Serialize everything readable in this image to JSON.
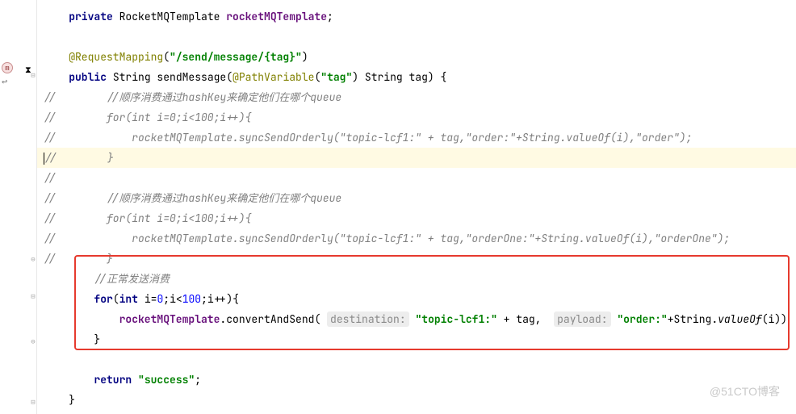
{
  "gutter": {
    "m_icon": "m"
  },
  "code": {
    "l1": {
      "kw": "private",
      "type": " RocketMQTemplate ",
      "field": "rocketMQTemplate",
      "semi": ";"
    },
    "l2": {
      "anno": "@RequestMapping",
      "paren_open": "(",
      "str": "\"/send/message/{tag}\"",
      "paren_close": ")"
    },
    "l3": {
      "kw1": "public",
      "type": " String ",
      "method": "sendMessage",
      "paren_open": "(",
      "anno": "@PathVariable",
      "anno_paren_open": "(",
      "anno_str": "\"tag\"",
      "anno_paren_close": ")",
      "param_type": " String tag",
      "paren_close": ") {"
    },
    "l4": {
      "cmt": "//        //顺序消费通过hashKey来确定他们在哪个queue"
    },
    "l5": {
      "slash": "//",
      "cmt": "        for(int i=0;i<100;i++){"
    },
    "l6": {
      "slash": "//",
      "cmt": "            rocketMQTemplate.syncSendOrderly(\"topic-lcf1:\" + tag,\"order:\"+String.valueOf(i),\"order\");"
    },
    "l7": {
      "slash": "//",
      "cmt": "        }"
    },
    "l8": {
      "slash": "//",
      "cmt": ""
    },
    "l9": {
      "slash": "//",
      "cmt": "        //顺序消费通过hashKey来确定他们在哪个queue"
    },
    "l10": {
      "slash": "//",
      "cmt": "        for(int i=0;i<100;i++){"
    },
    "l11": {
      "slash": "//",
      "cmt": "            rocketMQTemplate.syncSendOrderly(\"topic-lcf1:\" + tag,\"orderOne:\"+String.valueOf(i),\"orderOne\");"
    },
    "l12": {
      "slash": "//",
      "cmt": "        }"
    },
    "l13": {
      "cmt": "//正常发送消费"
    },
    "l14": {
      "kw_for": "for",
      "paren_open": "(",
      "kw_int": "int",
      "var": " i",
      "eq": "=",
      "n0": "0",
      "semi1": ";",
      "var2": "i",
      "lt": "<",
      "n100": "100",
      "semi2": ";",
      "var3": "i",
      "inc": "++",
      "paren_close": "){"
    },
    "l15": {
      "field": "rocketMQTemplate",
      "dot": ".",
      "method": "convertAndSend",
      "paren_open": "( ",
      "hint1": "destination:",
      "sp1": " ",
      "str1": "\"topic-lcf1:\"",
      "plus1": " + tag, ",
      "sp2": " ",
      "hint2": "payload:",
      "sp3": " ",
      "str2": "\"order:\"",
      "plus2": "+String.",
      "val": "valueOf",
      "paren_i": "(i))"
    },
    "l16": {
      "brace": "}"
    },
    "l17": {
      "kw": "return",
      "sp": " ",
      "str": "\"success\"",
      "semi": ";"
    },
    "l18": {
      "brace": "}"
    }
  },
  "watermark": "@51CTO博客"
}
